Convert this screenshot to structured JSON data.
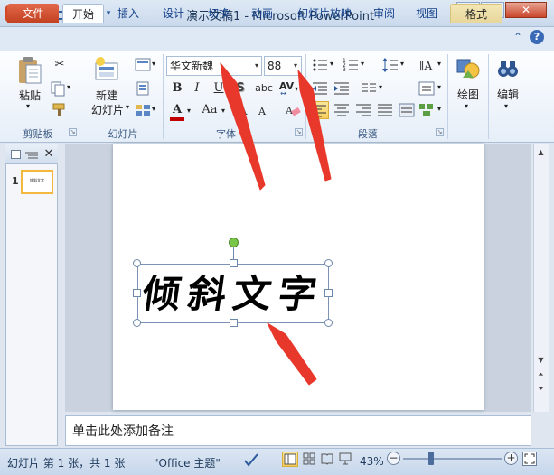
{
  "window": {
    "title": "演示文稿1 - Microsoft PowerPoint",
    "app_icon_letter": "P",
    "controls": [
      "minimize-icon",
      "maximize-icon",
      "close-icon"
    ]
  },
  "quick_access": [
    "save-icon",
    "undo-icon",
    "redo-icon",
    "customize-icon"
  ],
  "tabs": [
    {
      "label": "文件",
      "active": false
    },
    {
      "label": "开始",
      "active": true
    },
    {
      "label": "插入",
      "active": false
    },
    {
      "label": "设计",
      "active": false
    },
    {
      "label": "切换",
      "active": false
    },
    {
      "label": "动画",
      "active": false
    },
    {
      "label": "幻灯片放映",
      "active": false
    },
    {
      "label": "审阅",
      "active": false
    },
    {
      "label": "视图",
      "active": false
    },
    {
      "label": "格式",
      "active": false
    }
  ],
  "ribbon": {
    "clipboard": {
      "paste_label": "粘贴",
      "group_label": "剪贴板"
    },
    "slides": {
      "new_slide_line1": "新建",
      "new_slide_line2": "幻灯片",
      "group_label": "幻灯片"
    },
    "font": {
      "font_name": "华文新魏",
      "font_size": "88",
      "bold": "B",
      "italic": "I",
      "underline": "U",
      "shadow": "S",
      "strikethrough": "abc",
      "spacing": "AV",
      "font_color_letter": "A",
      "change_case": "Aa",
      "grow": "A",
      "shrink": "A",
      "group_label": "字体"
    },
    "paragraph": {
      "group_label": "段落",
      "selected_alignment": "align-left"
    },
    "drawing": {
      "label": "绘图"
    },
    "editing": {
      "label": "编辑"
    }
  },
  "slide_panel": {
    "slide_number": "1",
    "thumb_text": "倾斜文字"
  },
  "slide": {
    "textbox_text": "倾斜文字"
  },
  "notes": {
    "placeholder": "单击此处添加备注"
  },
  "status": {
    "slide_info": "幻灯片 第 1 张，共 1 张",
    "theme": "\"Office 主题\"",
    "zoom": "43%"
  },
  "colors": {
    "accent_red": "#e8382b",
    "file_tab": "#c1401f",
    "font_color_bar": "#c00000",
    "highlight": "#f6cf5c"
  }
}
